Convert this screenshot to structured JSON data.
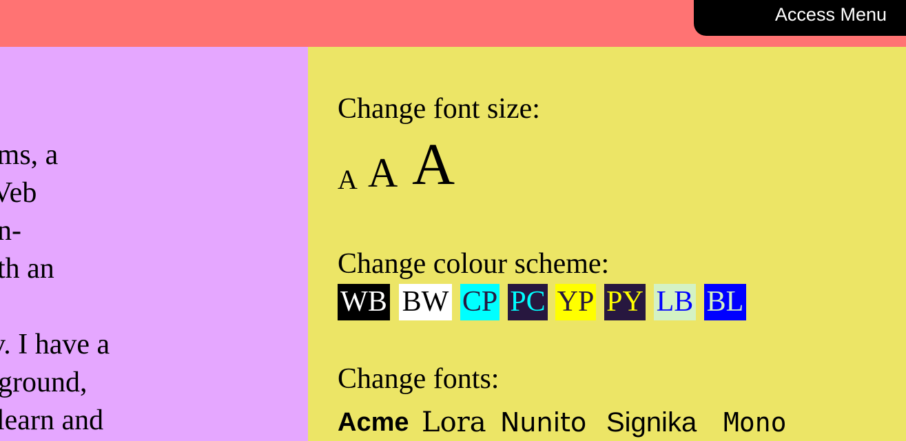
{
  "topbar": {
    "access_menu_label": "Access Menu"
  },
  "left_text": {
    "lines": [
      "mms, a",
      "Veb",
      "n-",
      "th an",
      "v. I have a",
      "ground,",
      "learn and"
    ]
  },
  "access_panel": {
    "font_size": {
      "title": "Change font size:",
      "options": [
        "A",
        "A",
        "A"
      ]
    },
    "colour_scheme": {
      "title": "Change colour scheme:",
      "options": [
        {
          "label": "WB",
          "fg": "#ffffff",
          "bg": "#000000"
        },
        {
          "label": "BW",
          "fg": "#000000",
          "bg": "#ffffff"
        },
        {
          "label": "CP",
          "fg": "#27173f",
          "bg": "#00ffff"
        },
        {
          "label": "PC",
          "fg": "#00ffff",
          "bg": "#27173f"
        },
        {
          "label": "YP",
          "fg": "#27173f",
          "bg": "#ffff00"
        },
        {
          "label": "PY",
          "fg": "#ffff00",
          "bg": "#27173f"
        },
        {
          "label": "LB",
          "fg": "#0000ff",
          "bg": "#d4f2c4"
        },
        {
          "label": "BL",
          "fg": "#d4f2c4",
          "bg": "#0000ff"
        }
      ]
    },
    "fonts": {
      "title": "Change fonts:",
      "options": [
        "Acme",
        "Lora",
        "Nunito",
        "Signika",
        "Mono"
      ]
    }
  },
  "colors": {
    "topbar": "#ff7373",
    "left_panel": "#e5a7ff",
    "access_panel": "#ece566"
  }
}
